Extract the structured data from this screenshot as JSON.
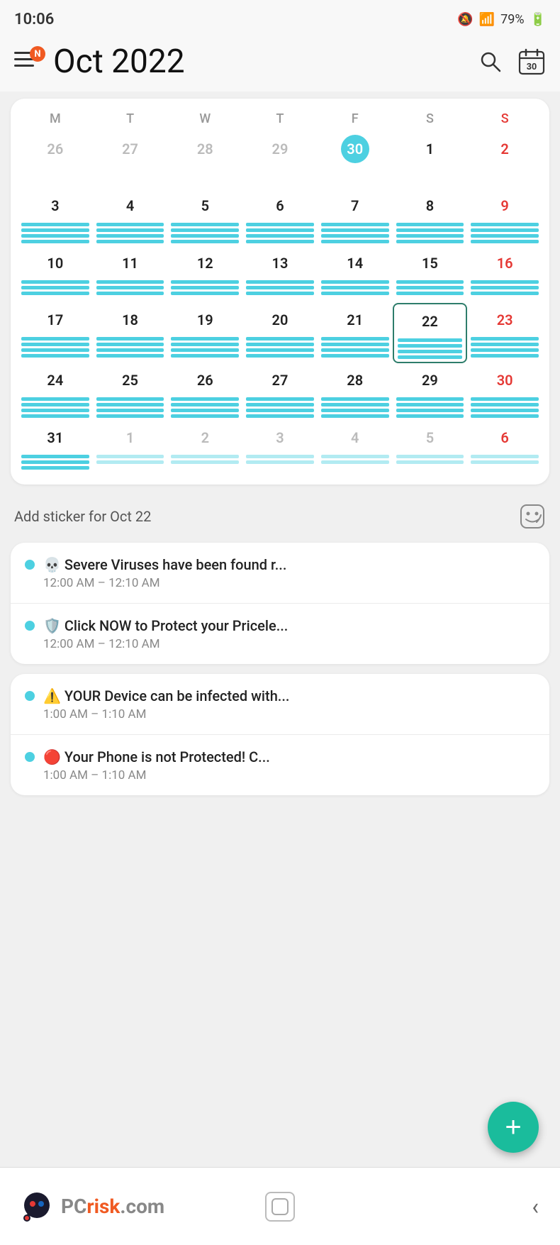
{
  "status_bar": {
    "time": "10:06",
    "battery": "79%"
  },
  "header": {
    "title": "Oct  2022",
    "notification_badge": "N",
    "search_label": "search",
    "calendar_label": "calendar",
    "calendar_date": "30"
  },
  "calendar": {
    "weekdays": [
      "M",
      "T",
      "W",
      "T",
      "F",
      "S",
      "S"
    ],
    "rows": [
      [
        {
          "day": "26",
          "type": "other",
          "events": 0
        },
        {
          "day": "27",
          "type": "other",
          "events": 0
        },
        {
          "day": "28",
          "type": "other",
          "events": 0
        },
        {
          "day": "29",
          "type": "other",
          "events": 0
        },
        {
          "day": "30",
          "type": "today",
          "events": 0
        },
        {
          "day": "1",
          "type": "normal",
          "events": 0
        },
        {
          "day": "2",
          "type": "sunday",
          "events": 0
        }
      ],
      [
        {
          "day": "3",
          "type": "normal",
          "events": 4
        },
        {
          "day": "4",
          "type": "normal",
          "events": 4
        },
        {
          "day": "5",
          "type": "normal",
          "events": 4
        },
        {
          "day": "6",
          "type": "normal",
          "events": 4
        },
        {
          "day": "7",
          "type": "normal",
          "events": 4
        },
        {
          "day": "8",
          "type": "normal",
          "events": 4
        },
        {
          "day": "9",
          "type": "sunday",
          "events": 4
        }
      ],
      [
        {
          "day": "10",
          "type": "normal",
          "events": 3
        },
        {
          "day": "11",
          "type": "normal",
          "events": 3
        },
        {
          "day": "12",
          "type": "normal",
          "events": 3
        },
        {
          "day": "13",
          "type": "normal",
          "events": 3
        },
        {
          "day": "14",
          "type": "normal",
          "events": 3
        },
        {
          "day": "15",
          "type": "normal",
          "events": 3
        },
        {
          "day": "16",
          "type": "sunday",
          "events": 3
        }
      ],
      [
        {
          "day": "17",
          "type": "normal",
          "events": 4
        },
        {
          "day": "18",
          "type": "normal",
          "events": 4
        },
        {
          "day": "19",
          "type": "normal",
          "events": 4
        },
        {
          "day": "20",
          "type": "normal",
          "events": 4
        },
        {
          "day": "21",
          "type": "normal",
          "events": 4
        },
        {
          "day": "22",
          "type": "selected",
          "events": 4
        },
        {
          "day": "23",
          "type": "sunday",
          "events": 4
        }
      ],
      [
        {
          "day": "24",
          "type": "normal",
          "events": 4
        },
        {
          "day": "25",
          "type": "normal",
          "events": 4
        },
        {
          "day": "26",
          "type": "normal",
          "events": 4
        },
        {
          "day": "27",
          "type": "normal",
          "events": 4
        },
        {
          "day": "28",
          "type": "normal",
          "events": 4
        },
        {
          "day": "29",
          "type": "normal",
          "events": 4
        },
        {
          "day": "30",
          "type": "sunday",
          "events": 4
        }
      ],
      [
        {
          "day": "31",
          "type": "normal",
          "events": 3
        },
        {
          "day": "1",
          "type": "other",
          "events": 2
        },
        {
          "day": "2",
          "type": "other",
          "events": 2
        },
        {
          "day": "3",
          "type": "other",
          "events": 2
        },
        {
          "day": "4",
          "type": "other",
          "events": 2
        },
        {
          "day": "5",
          "type": "other",
          "events": 2
        },
        {
          "day": "6",
          "type": "other-sunday",
          "events": 2
        }
      ]
    ]
  },
  "add_sticker": {
    "label": "Add sticker for Oct 22"
  },
  "event_groups": [
    {
      "events": [
        {
          "icon": "💀",
          "title": "Severe Viruses have been found r...",
          "time": "12:00 AM – 12:10 AM"
        },
        {
          "icon": "🛡️",
          "title": "Click NOW to Protect your Pricele...",
          "time": "12:00 AM – 12:10 AM"
        }
      ]
    },
    {
      "events": [
        {
          "icon": "⚠️",
          "title": "YOUR Device can be infected with...",
          "time": "1:00 AM – 1:10 AM"
        },
        {
          "icon": "🔴",
          "title": "Your Phone is not Protected! C...",
          "time": "1:00 AM – 1:10 AM"
        }
      ]
    }
  ],
  "fab": {
    "label": "+"
  },
  "bottom_bar": {
    "logo_pc": "PC",
    "logo_risk": "risk",
    "logo_com": ".com"
  }
}
